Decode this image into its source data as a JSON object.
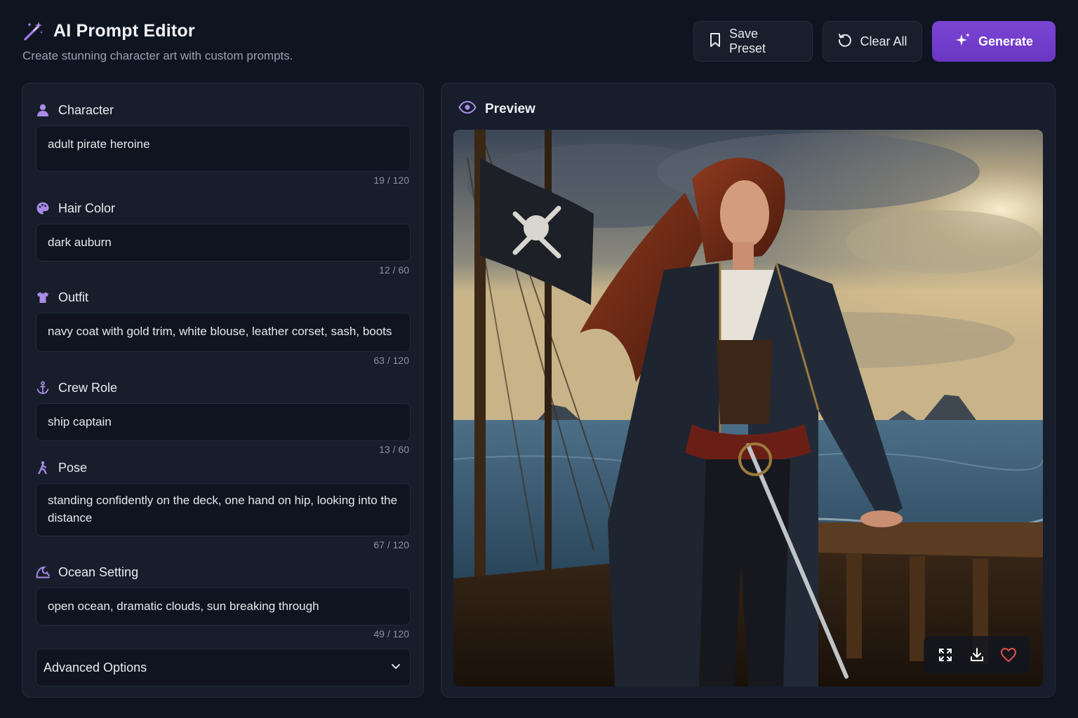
{
  "header": {
    "title": "AI Prompt Editor",
    "subtitle": "Create stunning character art with custom prompts."
  },
  "actions": {
    "save_label": "Save Preset",
    "clear_label": "Clear All",
    "generate_label": "Generate"
  },
  "fields": {
    "character": {
      "label": "Character",
      "value": "adult pirate heroine",
      "counter": "19 / 120",
      "icon": "user-icon"
    },
    "hair": {
      "label": "Hair Color",
      "value": "dark auburn",
      "counter": "12 / 60",
      "icon": "palette-icon"
    },
    "outfit": {
      "label": "Outfit",
      "value": "navy coat with gold trim, white blouse, leather corset, sash, boots",
      "counter": "63 / 120",
      "icon": "shirt-icon"
    },
    "crew": {
      "label": "Crew Role",
      "value": "ship captain",
      "counter": "13 / 60",
      "icon": "anchor-icon"
    },
    "pose": {
      "label": "Pose",
      "value": "standing confidently on the deck, one hand on hip, looking into the distance",
      "counter": "67 / 120",
      "icon": "person-pose-icon"
    },
    "ocean": {
      "label": "Ocean Setting",
      "value": "open ocean, dramatic clouds, sun breaking through",
      "counter": "49 / 120",
      "icon": "wave-icon"
    }
  },
  "advanced": {
    "label": "Advanced Options"
  },
  "preview": {
    "title": "Preview",
    "image_description": "pirate heroine on ship deck"
  },
  "colors": {
    "accent": "#7340cc",
    "background": "#0f1421",
    "panel": "#171d2b"
  }
}
